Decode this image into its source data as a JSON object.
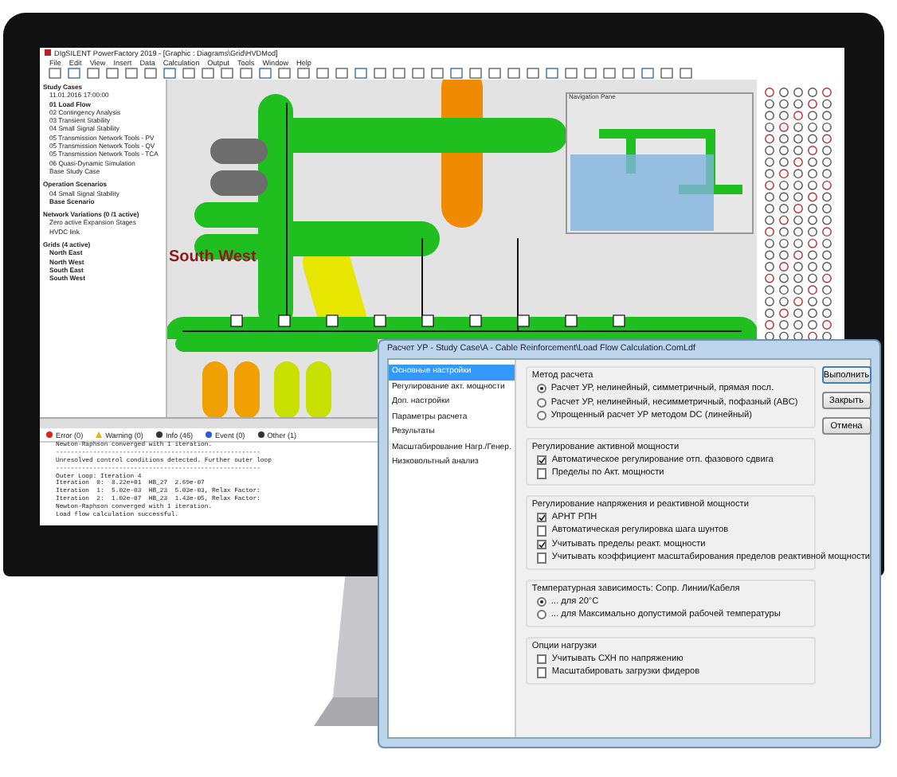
{
  "app": {
    "title": "DIgSILENT PowerFactory 2019 - [Graphic : Diagrams\\Grid\\HVDMod]",
    "menu": [
      "File",
      "Edit",
      "View",
      "Insert",
      "Data",
      "Calculation",
      "Output",
      "Tools",
      "Window",
      "Help"
    ],
    "tree": [
      {
        "label": "Study Cases",
        "children": [
          {
            "label": "11.01.2016 17:00:00",
            "active": false
          },
          {
            "label": "01 Load Flow",
            "active": true
          },
          {
            "label": "02 Contingency Analysis",
            "active": false
          },
          {
            "label": "03 Transient Stability",
            "active": false
          },
          {
            "label": "04 Small Signal Stability",
            "active": false
          },
          {
            "label": "05 Transmission Network Tools - PV",
            "active": false
          },
          {
            "label": "05 Transmission Network Tools - QV",
            "active": false
          },
          {
            "label": "05 Transmission Network Tools - TCA",
            "active": false
          },
          {
            "label": "06 Quasi-Dynamic Simulation",
            "active": false
          },
          {
            "label": "Base Study Case",
            "active": false
          }
        ]
      },
      {
        "label": "Operation Scenarios",
        "children": [
          {
            "label": "04 Small Signal Stability",
            "active": false
          },
          {
            "label": "Base Scenario",
            "active": true
          }
        ]
      },
      {
        "label": "Network Variations (0 /1 active)",
        "children": [
          {
            "label": "Zero active Expansion Stages",
            "active": false
          },
          {
            "label": "HVDC link",
            "active": false
          }
        ]
      },
      {
        "label": "Grids (4 active)",
        "children": [
          {
            "label": "North East",
            "active": true
          },
          {
            "label": "North West",
            "active": true
          },
          {
            "label": "South East",
            "active": true
          },
          {
            "label": "South West",
            "active": true
          }
        ]
      }
    ],
    "area_label": "South West",
    "navigation_pane": {
      "title": "Navigation Pane"
    },
    "log_tabs": [
      {
        "kind": "error",
        "label": "Error (0)"
      },
      {
        "kind": "warning",
        "label": "Warning (0)"
      },
      {
        "kind": "info",
        "label": "Info (46)"
      },
      {
        "kind": "event",
        "label": "Event (0)"
      },
      {
        "kind": "other",
        "label": "Other (1)"
      }
    ],
    "log": [
      "Newton-Raphson converged with 1 iteration.",
      "-------------------------------------------------------",
      "Unresolved control conditions detected. Further outer loop",
      "-------------------------------------------------------",
      "Outer Loop: Iteration 4",
      "Iteration  0:  8.22e+01  HB_27  2.69e-07",
      "Iteration  1:  5.02e-03  HB_23  5.03e-03, Relax Factor:",
      "Iteration  2:  1.02e-07  HB_23  1.43e-05, Relax Factor:",
      "Newton-Raphson converged with 1 iteration.",
      "Load flow calculation successful."
    ]
  },
  "dialog": {
    "title": "Расчет УР - Study Case\\A - Cable Reinforcement\\Load Flow Calculation.ComLdf",
    "nav": [
      {
        "label": "Основные настройки",
        "selected": true
      },
      {
        "label": "Регулирование акт. мощности",
        "selected": false
      },
      {
        "label": "Доп. настройки",
        "selected": false
      },
      {
        "label": "Параметры расчета",
        "selected": false
      },
      {
        "label": "Результаты",
        "selected": false
      },
      {
        "label": "Масштабирование Нагр./Генер.",
        "selected": false
      },
      {
        "label": "Низковольтный анализ",
        "selected": false
      }
    ],
    "groups": [
      {
        "title": "Метод расчета",
        "options": [
          {
            "kind": "radio",
            "label": "Расчет УР, нелинейный, симметричный, прямая посл.",
            "selected": true
          },
          {
            "kind": "radio",
            "label": "Расчет УР, нелинейный, несимметричный, пофазный (ABC)",
            "selected": false
          },
          {
            "kind": "radio",
            "label": "Упрощенный расчет УР методом DC (линейный)",
            "selected": false
          }
        ]
      },
      {
        "title": "Регулирование активной мощности",
        "options": [
          {
            "kind": "checkbox",
            "label": "Автоматическое регулирование отп. фазового сдвига",
            "checked": true
          },
          {
            "kind": "checkbox",
            "label": "Пределы по Акт. мощности",
            "checked": false
          }
        ]
      },
      {
        "title": "Регулирование напряжения и реактивной мощности",
        "options": [
          {
            "kind": "checkbox",
            "label": "АРНТ РПН",
            "checked": true
          },
          {
            "kind": "checkbox",
            "label": "Автоматическая регулировка шага шунтов",
            "checked": false
          },
          {
            "kind": "checkbox",
            "label": "Учитывать пределы реакт. мощности",
            "checked": true
          },
          {
            "kind": "checkbox",
            "label": "Учитывать коэффициент масштабирования пределов реактивной мощности",
            "checked": false
          }
        ]
      },
      {
        "title": "Температурная зависимость: Сопр. Линии/Кабеля",
        "options": [
          {
            "kind": "radio",
            "label": "... для 20°C",
            "selected": true
          },
          {
            "kind": "radio",
            "label": "... для Максимально допустимой рабочей температуры",
            "selected": false
          }
        ]
      },
      {
        "title": "Опции нагрузки",
        "options": [
          {
            "kind": "checkbox",
            "label": "Учитывать СХН по напряжению",
            "checked": false
          },
          {
            "kind": "checkbox",
            "label": "Масштабировать загрузки фидеров",
            "checked": false
          }
        ]
      }
    ],
    "buttons": [
      "Выполнить",
      "Закрыть",
      "Отмена"
    ]
  }
}
